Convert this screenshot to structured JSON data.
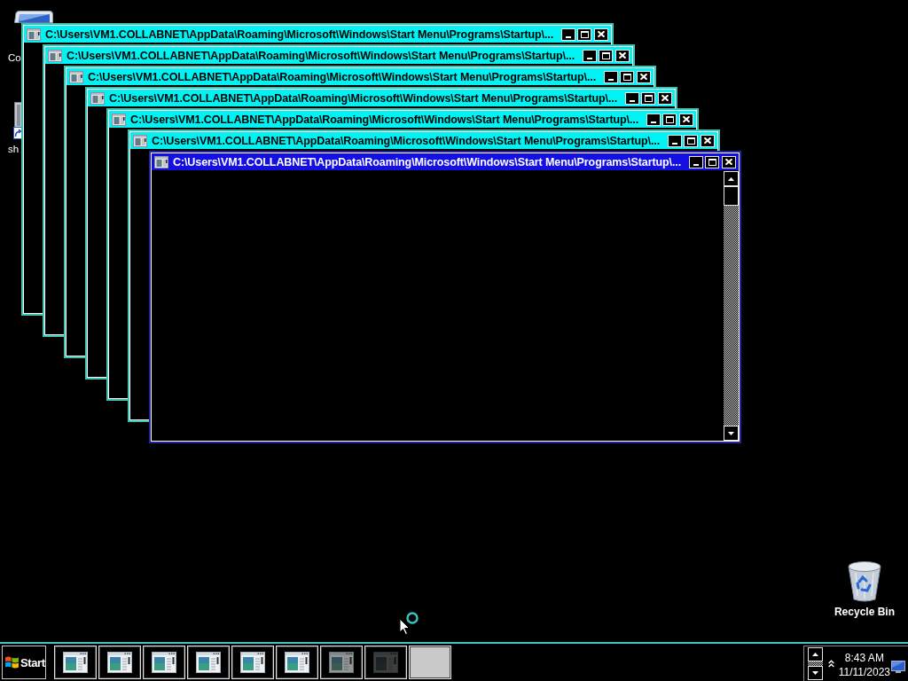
{
  "desktop": {
    "left_icons": [
      {
        "kind": "computer",
        "label": "Co"
      },
      {
        "kind": "shortcut",
        "label": "sh"
      }
    ],
    "right_icons": [
      {
        "kind": "recycle-bin",
        "label": "Recycle Bin"
      }
    ]
  },
  "windows": [
    {
      "title": "C:\\Users\\VM1.COLLABNET\\AppData\\Roaming\\Microsoft\\Windows\\Start Menu\\Programs\\Startup\\...",
      "active": false
    },
    {
      "title": "C:\\Users\\VM1.COLLABNET\\AppData\\Roaming\\Microsoft\\Windows\\Start Menu\\Programs\\Startup\\...",
      "active": false
    },
    {
      "title": "C:\\Users\\VM1.COLLABNET\\AppData\\Roaming\\Microsoft\\Windows\\Start Menu\\Programs\\Startup\\...",
      "active": false
    },
    {
      "title": "C:\\Users\\VM1.COLLABNET\\AppData\\Roaming\\Microsoft\\Windows\\Start Menu\\Programs\\Startup\\...",
      "active": false
    },
    {
      "title": "C:\\Users\\VM1.COLLABNET\\AppData\\Roaming\\Microsoft\\Windows\\Start Menu\\Programs\\Startup\\...",
      "active": false
    },
    {
      "title": "C:\\Users\\VM1.COLLABNET\\AppData\\Roaming\\Microsoft\\Windows\\Start Menu\\Programs\\Startup\\...",
      "active": false
    },
    {
      "title": "C:\\Users\\VM1.COLLABNET\\AppData\\Roaming\\Microsoft\\Windows\\Start Menu\\Programs\\Startup\\...",
      "active": true
    }
  ],
  "taskbar": {
    "start": "Start",
    "buttons": [
      {
        "kind": "app"
      },
      {
        "kind": "app"
      },
      {
        "kind": "app"
      },
      {
        "kind": "app"
      },
      {
        "kind": "app"
      },
      {
        "kind": "app"
      },
      {
        "kind": "app-faded"
      },
      {
        "kind": "app-dark"
      },
      {
        "kind": "empty"
      }
    ],
    "tray": {
      "time": "8:43 AM",
      "date": "11/11/2023"
    }
  }
}
